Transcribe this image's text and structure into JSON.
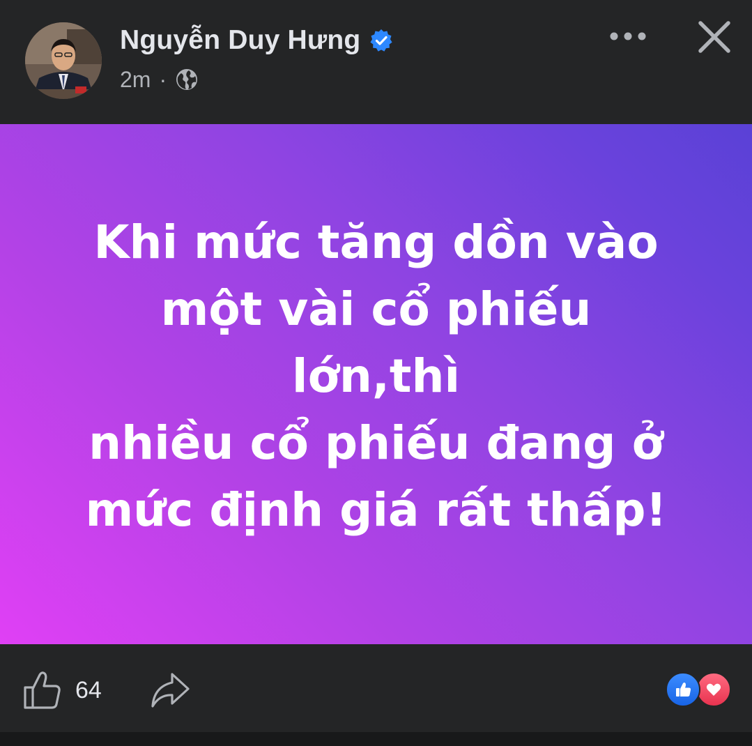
{
  "post": {
    "author": "Nguyễn Duy Hưng",
    "time": "2m",
    "separator": "·",
    "audience_icon": "globe-icon",
    "verified_icon": "verified-badge-icon",
    "text_lines": [
      "Khi mức tăng dồn vào",
      "một vài cổ phiếu lớn,thì",
      "nhiều cổ phiếu đang ở",
      "mức định giá rất thấp!"
    ],
    "background_gradient": [
      "#e040f5",
      "#5a41d6"
    ]
  },
  "footer": {
    "like_count": "64",
    "reactions": [
      "like-reaction-icon",
      "love-reaction-icon"
    ]
  },
  "colors": {
    "background": "#242526",
    "text_primary": "#e4e6eb",
    "text_secondary": "#b0b3b8",
    "verified_blue": "#2d88ff"
  }
}
